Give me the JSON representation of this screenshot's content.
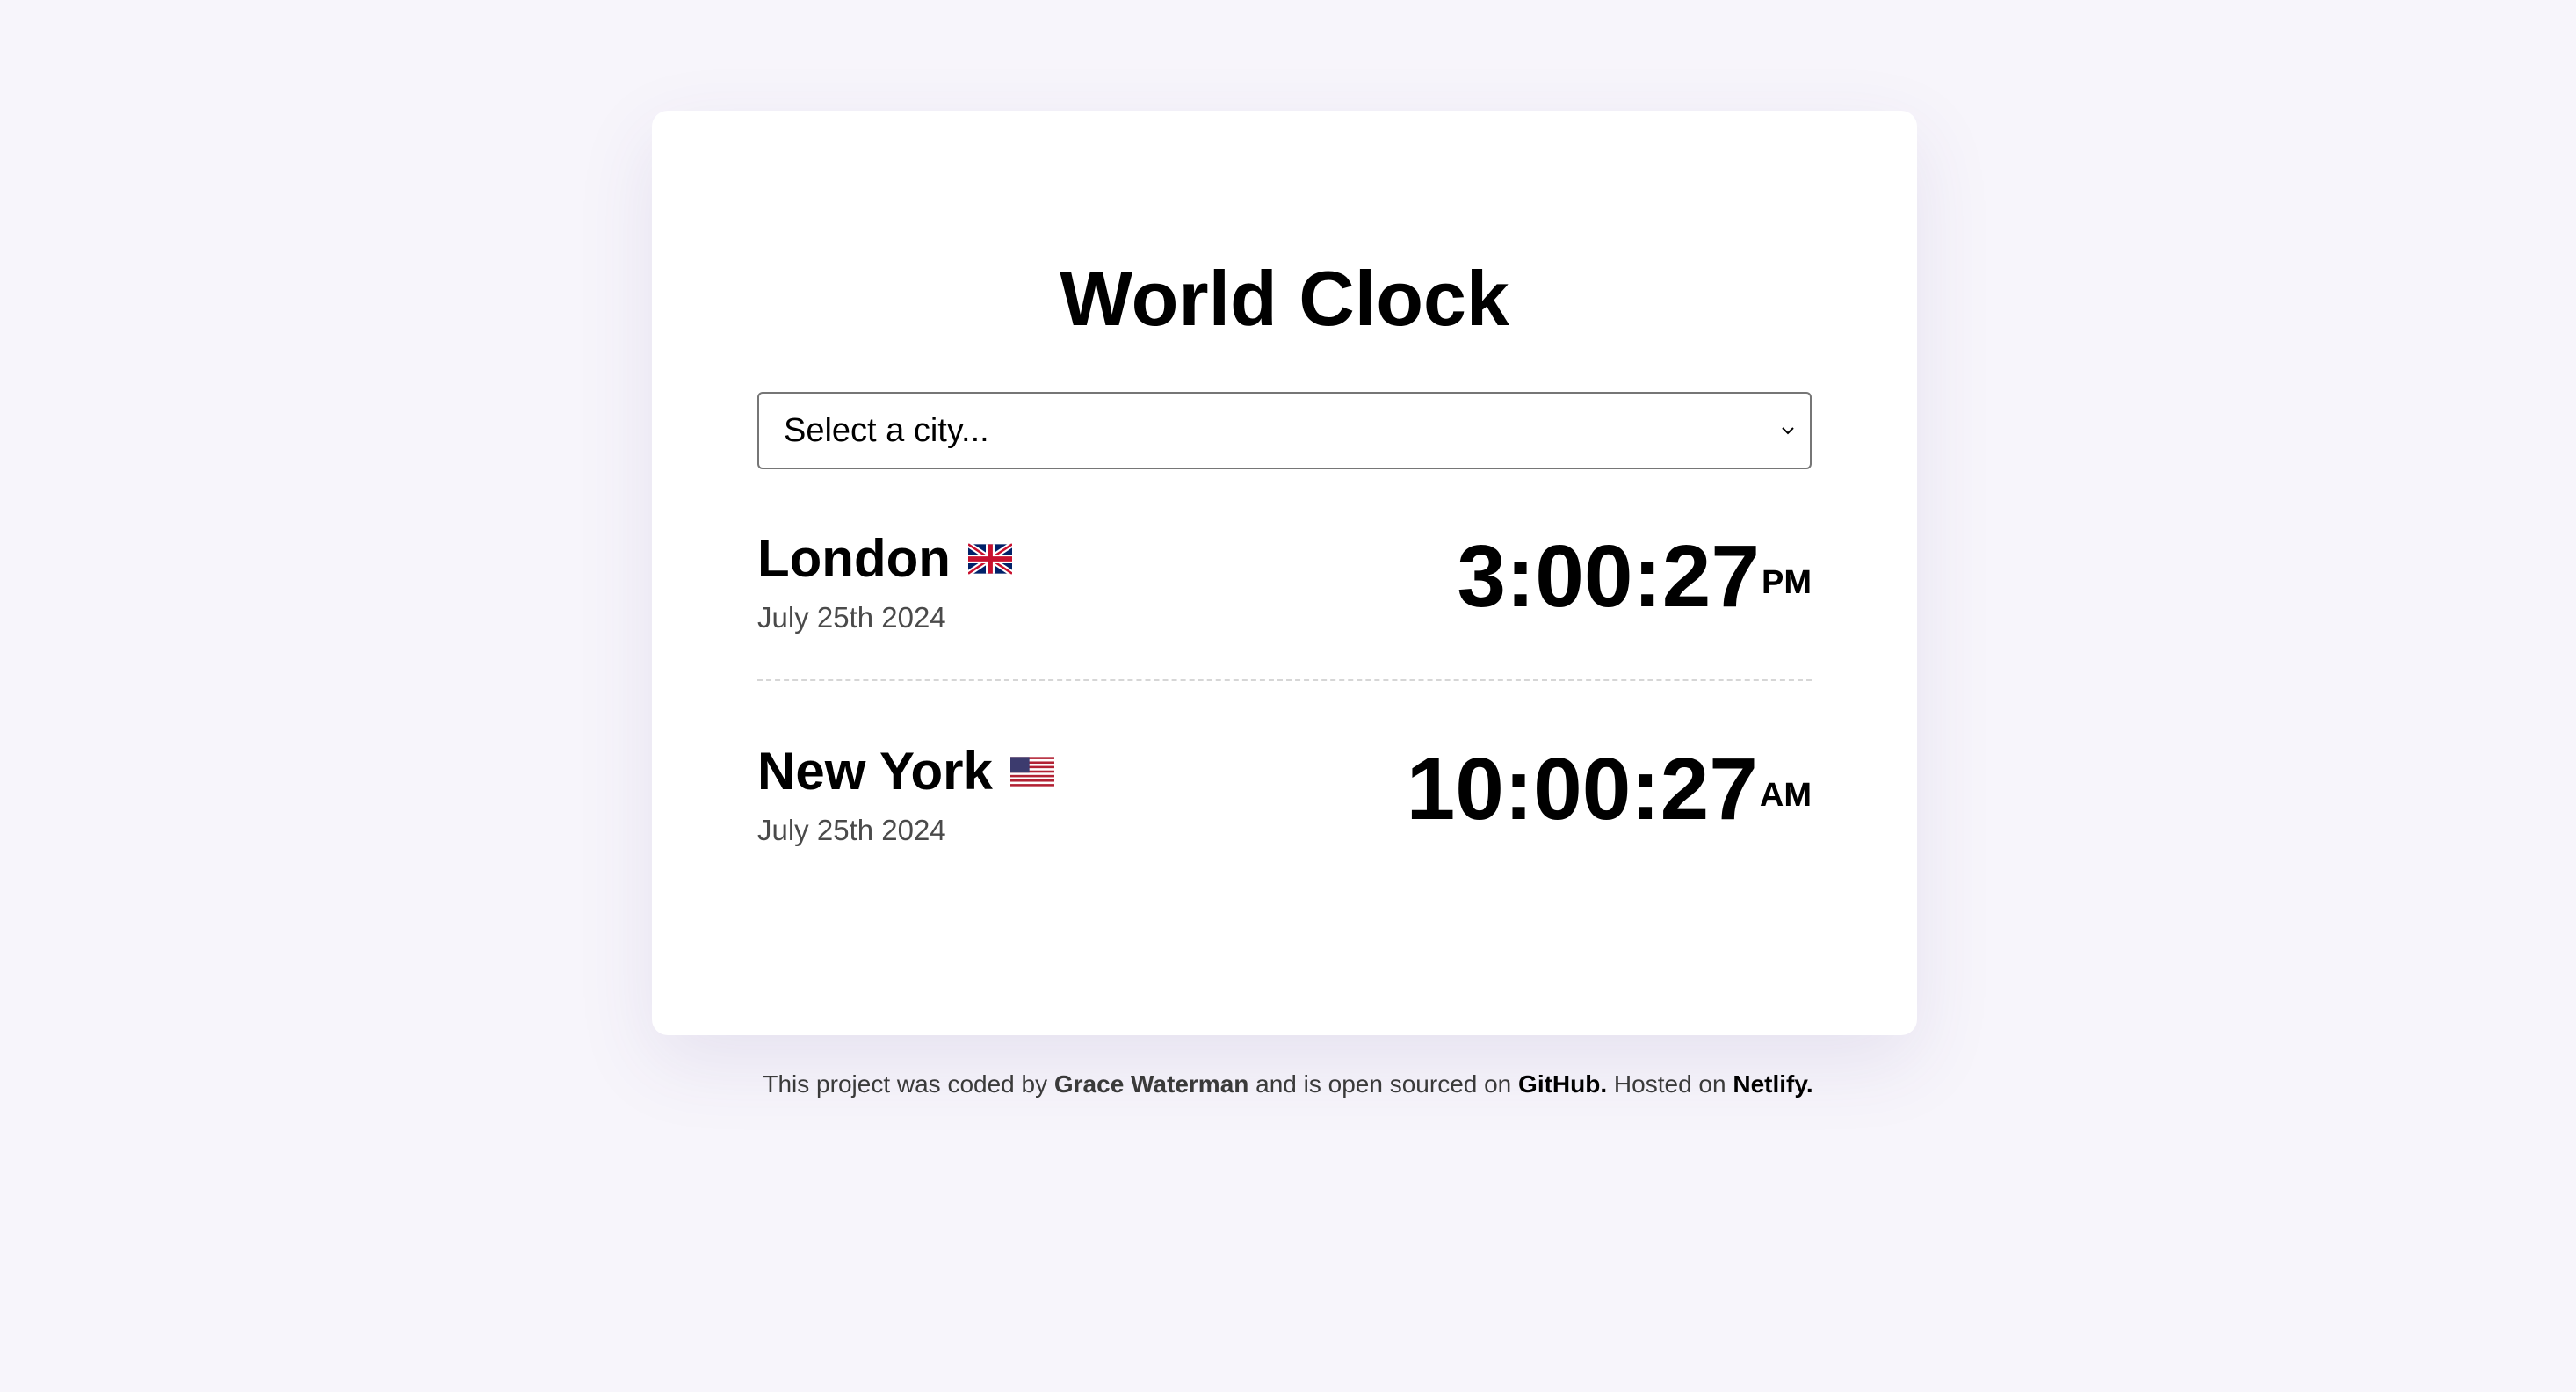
{
  "app": {
    "title": "World Clock"
  },
  "city_select": {
    "selected_label": "Select a city...",
    "chevron_icon": "chevron-down-icon"
  },
  "cities": [
    {
      "name": "London",
      "flag_icon": "uk-flag-icon",
      "date": "July 25th 2024",
      "time": "3:00:27",
      "ampm": "PM"
    },
    {
      "name": "New York",
      "flag_icon": "us-flag-icon",
      "date": "July 25th 2024",
      "time": "10:00:27",
      "ampm": "AM"
    }
  ],
  "footer": {
    "text_1": "This project was coded by",
    "author": "Grace Waterman",
    "text_2": "and is open sourced on",
    "github_label": "GitHub.",
    "text_3": "Hosted on",
    "netlify_label": "Netlify."
  },
  "colors": {
    "background": "#f7f5fb",
    "card": "#ffffff",
    "text": "#000000",
    "muted_text": "#4a4a4a"
  }
}
